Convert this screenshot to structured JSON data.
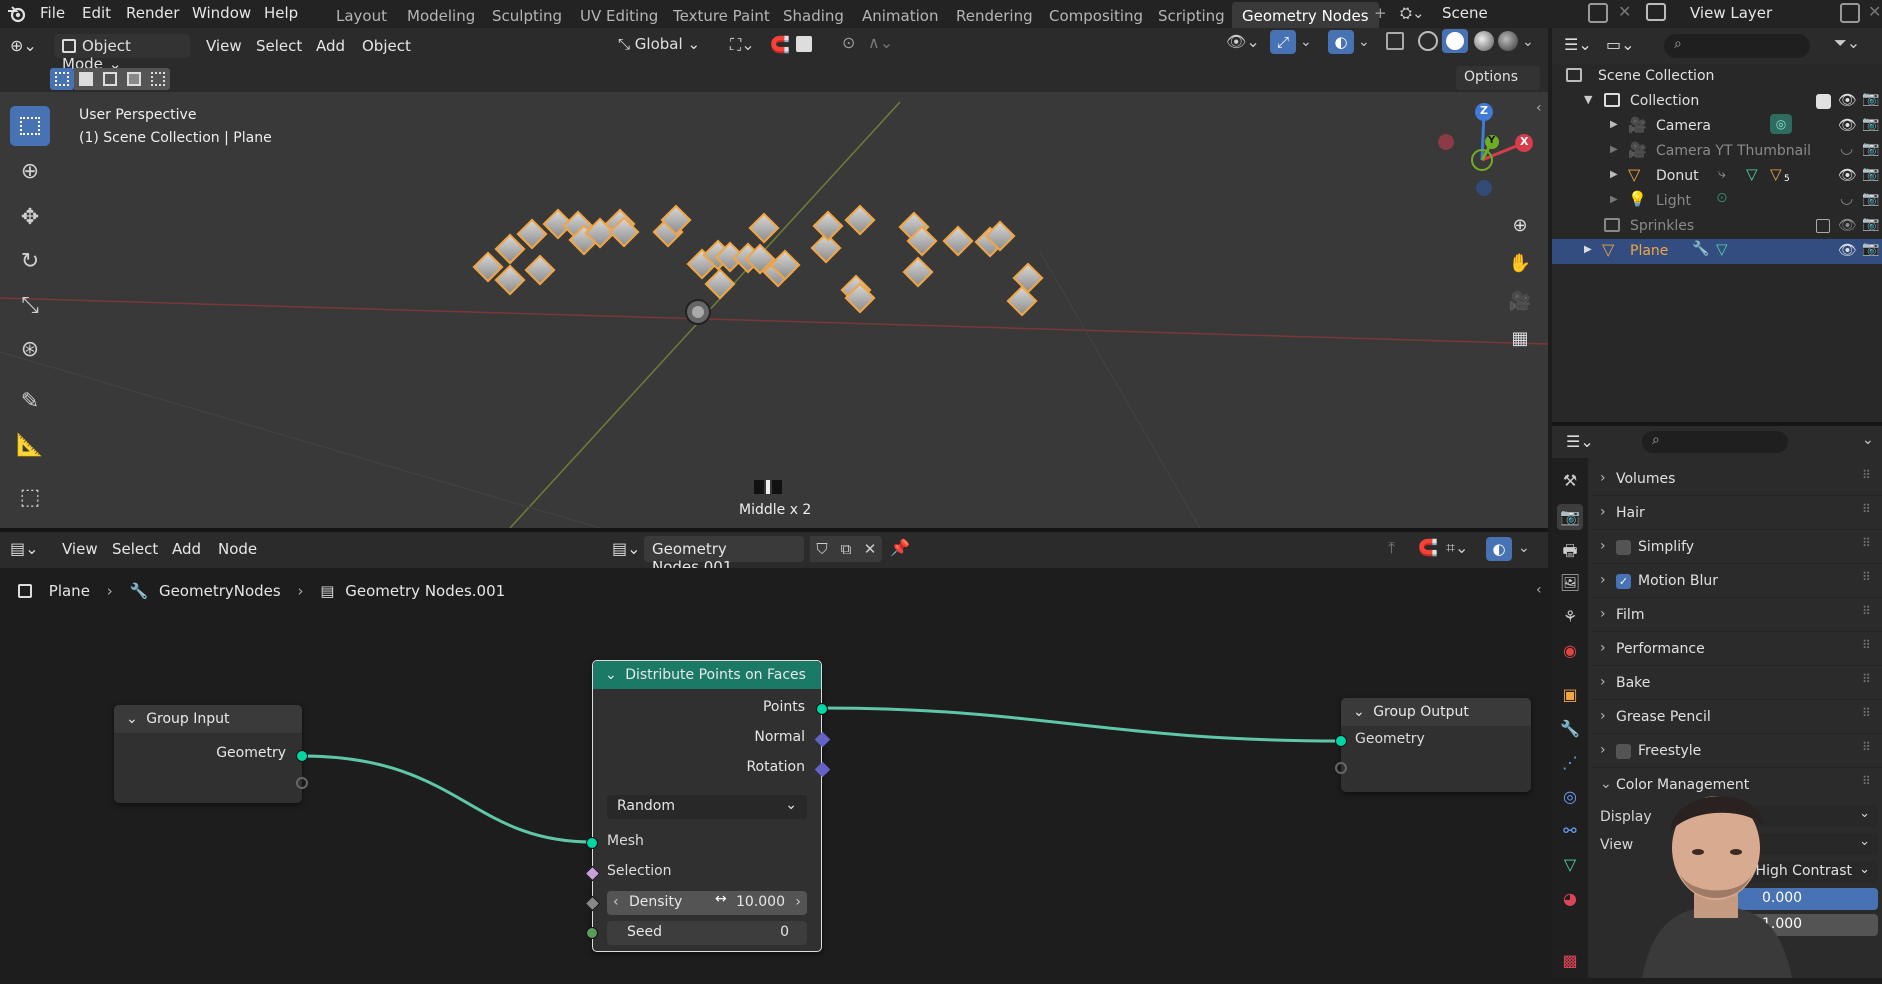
{
  "topbar": {
    "menus": [
      "File",
      "Edit",
      "Render",
      "Window",
      "Help"
    ],
    "workspaces": [
      "Layout",
      "Modeling",
      "Sculpting",
      "UV Editing",
      "Texture Paint",
      "Shading",
      "Animation",
      "Rendering",
      "Compositing",
      "Scripting",
      "Geometry Nodes"
    ],
    "active_workspace": "Geometry Nodes",
    "add_ws": "+",
    "scene": "Scene",
    "view_layer": "View Layer"
  },
  "viewport_header": {
    "mode": "Object Mode",
    "menus": [
      "View",
      "Select",
      "Add",
      "Object"
    ],
    "transform": "Global",
    "options": "Options"
  },
  "viewport": {
    "line1": "User Perspective",
    "line2": "(1) Scene Collection | Plane",
    "gizmo_z": "Z",
    "gizmo_x": "X",
    "gizmo_y": "Y",
    "status": "Middle x 2"
  },
  "node_header": {
    "menus": [
      "View",
      "Select",
      "Add",
      "Node"
    ],
    "tree_name": "Geometry Nodes.001"
  },
  "breadcrumb": {
    "object": "Plane",
    "modifier": "GeometryNodes",
    "tree": "Geometry Nodes.001"
  },
  "nodes": {
    "group_input": {
      "title": "Group Input",
      "output": "Geometry"
    },
    "distribute": {
      "title": "Distribute Points on Faces",
      "outputs": [
        "Points",
        "Normal",
        "Rotation"
      ],
      "mode": "Random",
      "inputs": {
        "mesh": "Mesh",
        "selection": "Selection"
      },
      "density_label": "Density",
      "density_value": "10.000",
      "seed_label": "Seed",
      "seed_value": "0"
    },
    "group_output": {
      "title": "Group Output",
      "input": "Geometry"
    }
  },
  "outliner": {
    "scene_collection": "Scene Collection",
    "collection": "Collection",
    "items": [
      "Camera",
      "Camera YT Thumbnail",
      "Donut",
      "Light",
      "Sprinkles",
      "Plane"
    ],
    "donut_badge": "5"
  },
  "properties": {
    "panels": [
      "Volumes",
      "Hair",
      "Simplify",
      "Motion Blur",
      "Film",
      "Performance",
      "Bake",
      "Grease Pencil",
      "Freestyle",
      "Color Management"
    ],
    "display_label": "Display",
    "view_label": "View",
    "look": "High Contrast",
    "exposure": "0.000",
    "gamma": "1.000"
  },
  "colors": {
    "accent_green": "#1a7a66",
    "socket_geometry": "#00d6a3",
    "socket_vector": "#6363c7",
    "selection_orange": "#f1a543",
    "active_blue": "#334d80"
  }
}
